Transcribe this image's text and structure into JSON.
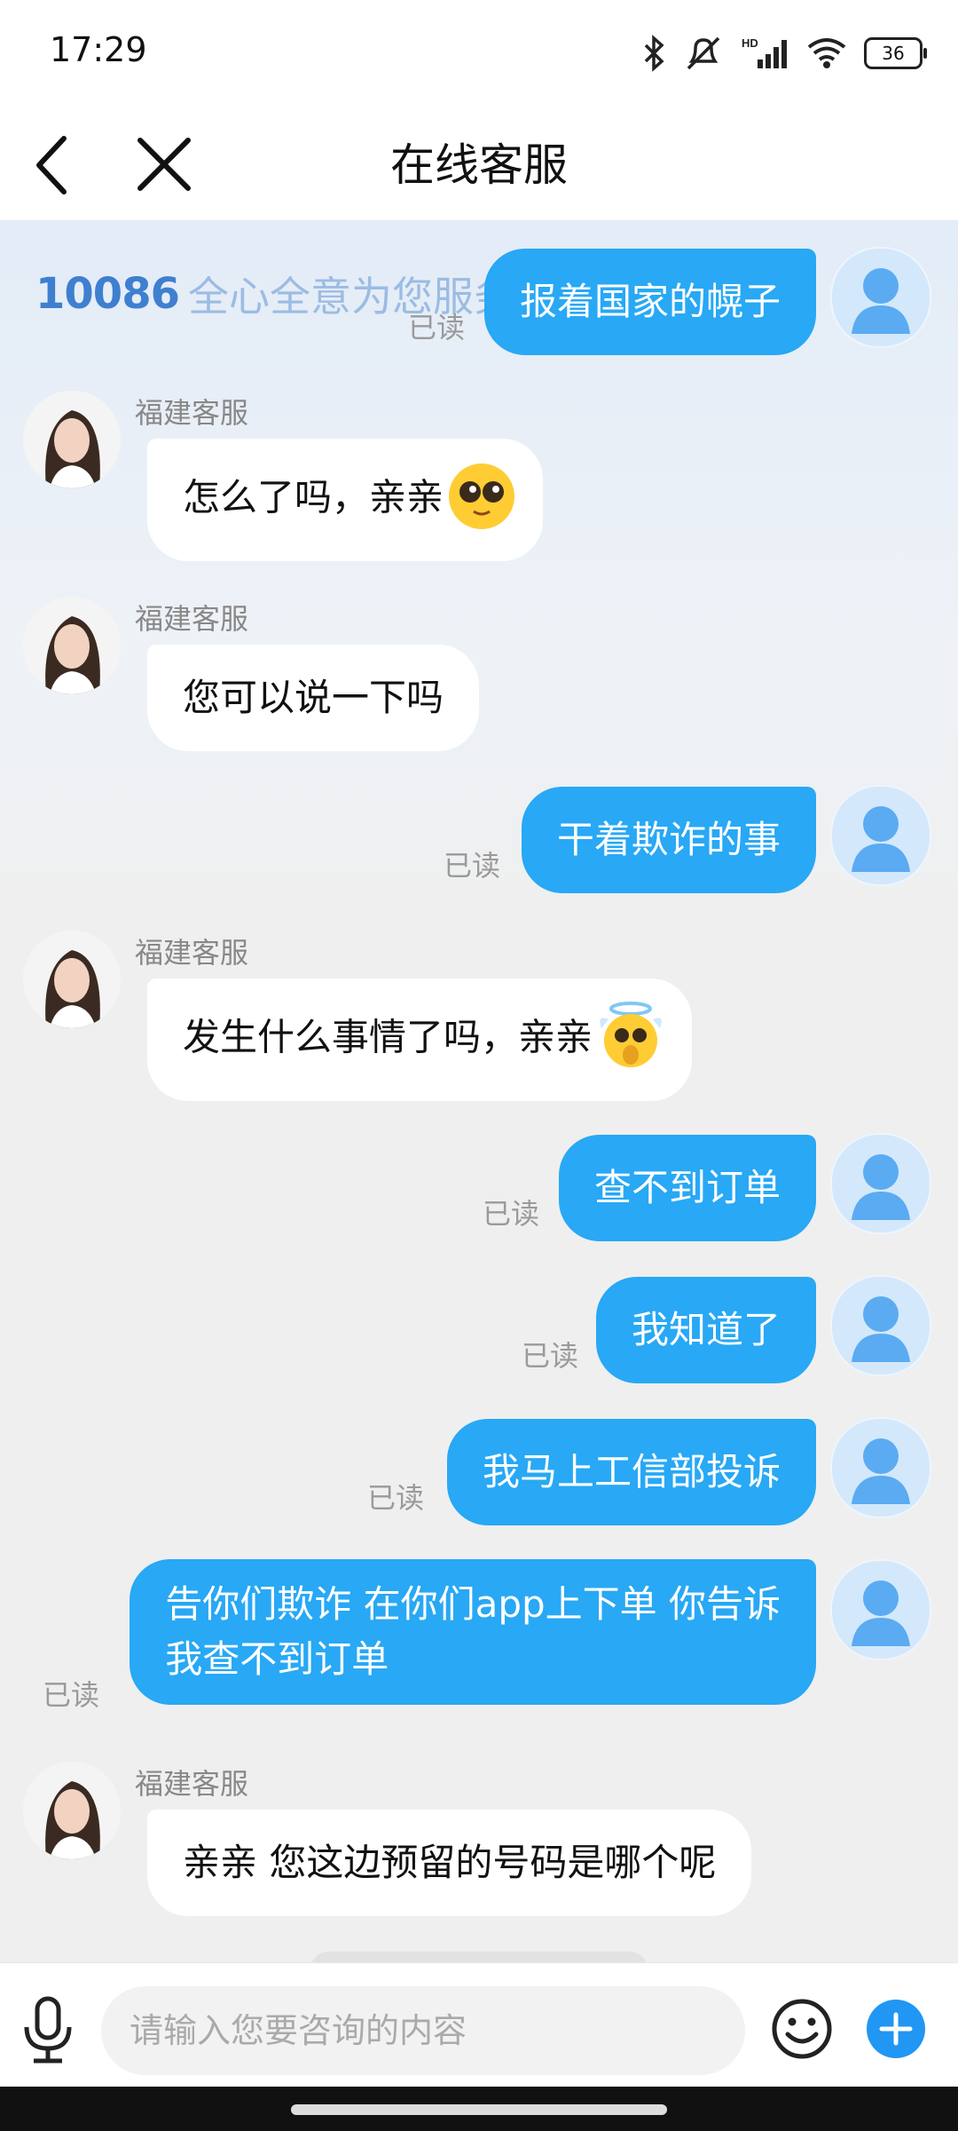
{
  "status": {
    "time": "17:29",
    "battery": "36",
    "icons": [
      "bluetooth-icon",
      "mute-icon",
      "hd-signal-icon",
      "wifi-icon",
      "battery-icon"
    ]
  },
  "nav": {
    "title": "在线客服",
    "back_icon": "chevron-left-icon",
    "close_icon": "close-icon"
  },
  "banner": {
    "logo": "10086",
    "slogan": "全心全意为您服务"
  },
  "agent_name": "福建客服",
  "read_label": "已读",
  "messages": [
    {
      "side": "out",
      "text": "报着国家的幌子"
    },
    {
      "side": "in",
      "text": "怎么了吗，亲亲",
      "emoji": "pleading-face"
    },
    {
      "side": "in",
      "text": "您可以说一下吗"
    },
    {
      "side": "out",
      "text": "干着欺诈的事"
    },
    {
      "side": "in",
      "text": "发生什么事情了吗，亲亲",
      "emoji": "angel-face"
    },
    {
      "side": "out",
      "text": "查不到订单"
    },
    {
      "side": "out",
      "text": "我知道了"
    },
    {
      "side": "out",
      "text": "我马上工信部投诉"
    },
    {
      "side": "out",
      "line1": "告你们欺诈 在你们app上下单 你告诉",
      "line2": "我查不到订单"
    },
    {
      "side": "in",
      "text": "亲亲 您这边预留的号码是哪个呢"
    }
  ],
  "input": {
    "placeholder": "请输入您要咨询的内容",
    "mic_icon": "microphone-icon",
    "emoji_icon": "smiley-icon",
    "add_icon": "plus-icon"
  },
  "colors": {
    "outgoing_bubble": "#28a8f5",
    "incoming_bubble": "#ffffff",
    "accent": "#2196f3"
  }
}
